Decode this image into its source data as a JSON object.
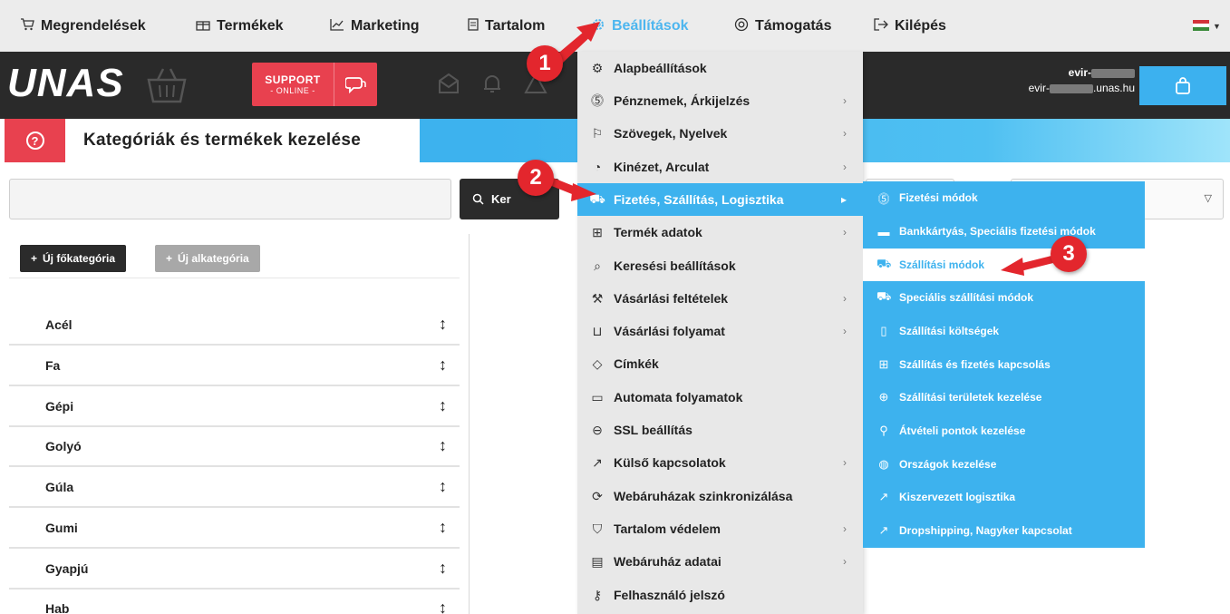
{
  "top_menu": {
    "items": [
      {
        "label": "Megrendelések",
        "icon": "cart-icon"
      },
      {
        "label": "Termékek",
        "icon": "gift-icon"
      },
      {
        "label": "Marketing",
        "icon": "chart-icon"
      },
      {
        "label": "Tartalom",
        "icon": "document-icon"
      },
      {
        "label": "Beállítások",
        "icon": "gear-icon",
        "active": true
      },
      {
        "label": "Támogatás",
        "icon": "lifebuoy-icon"
      },
      {
        "label": "Kilépés",
        "icon": "logout-icon"
      }
    ]
  },
  "header": {
    "logo": "UNAS",
    "support_line1": "SUPPORT",
    "support_line2": "- ONLINE -",
    "user_line1": "evir-",
    "user_line2_prefix": "evir-",
    "user_line2_suffix": ".unas.hu"
  },
  "page": {
    "title": "Kategóriák és termékek kezelése",
    "help_icon": "?"
  },
  "search": {
    "button_label": "Ker"
  },
  "categories": {
    "new_main_label": "Új főkategória",
    "new_sub_label": "Új alkategória",
    "items": [
      "Acél",
      "Fa",
      "Gépi",
      "Golyó",
      "Gúla",
      "Gumi",
      "Gyapjú",
      "Hab"
    ]
  },
  "settings_menu": {
    "items": [
      {
        "label": "Alapbeállítások",
        "icon": "gears-icon",
        "has_sub": false
      },
      {
        "label": "Pénznemek, Árkijelzés",
        "icon": "coin-icon",
        "has_sub": true
      },
      {
        "label": "Szövegek, Nyelvek",
        "icon": "flag-icon",
        "has_sub": true
      },
      {
        "label": "Kinézet, Arculat",
        "icon": "palette-icon",
        "has_sub": true
      },
      {
        "label": "Fizetés, Szállítás, Logisztika",
        "icon": "truck-icon",
        "has_sub": true,
        "highlighted": true
      },
      {
        "label": "Termék adatok",
        "icon": "gift-icon",
        "has_sub": true
      },
      {
        "label": "Keresési beállítások",
        "icon": "search-icon",
        "has_sub": false
      },
      {
        "label": "Vásárlási feltételek",
        "icon": "gavel-icon",
        "has_sub": true
      },
      {
        "label": "Vásárlási folyamat",
        "icon": "cart-icon",
        "has_sub": true
      },
      {
        "label": "Címkék",
        "icon": "tag-icon",
        "has_sub": false
      },
      {
        "label": "Automata folyamatok",
        "icon": "calendar-icon",
        "has_sub": false
      },
      {
        "label": "SSL beállítás",
        "icon": "lock-icon",
        "has_sub": false
      },
      {
        "label": "Külső kapcsolatok",
        "icon": "external-link-icon",
        "has_sub": true
      },
      {
        "label": "Webáruházak szinkronizálása",
        "icon": "sync-icon",
        "has_sub": false
      },
      {
        "label": "Tartalom védelem",
        "icon": "shield-icon",
        "has_sub": true
      },
      {
        "label": "Webáruház adatai",
        "icon": "file-icon",
        "has_sub": true
      },
      {
        "label": "Felhasználó jelszó",
        "icon": "key-icon",
        "has_sub": false
      }
    ]
  },
  "logistics_submenu": {
    "items": [
      {
        "label": "Fizetési módok",
        "icon": "coin-icon"
      },
      {
        "label": "Bankkártyás, Speciális fizetési módok",
        "icon": "credit-card-icon"
      },
      {
        "label": "Szállítási módok",
        "icon": "truck-icon",
        "selected": true
      },
      {
        "label": "Speciális szállítási módok",
        "icon": "truck-icon"
      },
      {
        "label": "Szállítási költségek",
        "icon": "receipt-icon"
      },
      {
        "label": "Szállítás és fizetés kapcsolás",
        "icon": "gift-icon"
      },
      {
        "label": "Szállítási területek kezelése",
        "icon": "area-icon"
      },
      {
        "label": "Átvételi pontok kezelése",
        "icon": "map-pin-icon"
      },
      {
        "label": "Országok kezelése",
        "icon": "globe-icon"
      },
      {
        "label": "Kiszervezett logisztika",
        "icon": "external-link-icon"
      },
      {
        "label": "Dropshipping, Nagyker kapcsolat",
        "icon": "external-link-icon"
      }
    ]
  },
  "markers": [
    "1",
    "2",
    "3"
  ],
  "colors": {
    "accent": "#3db2ee",
    "support_red": "#e8414f",
    "marker_red": "#e3262d",
    "dark": "#2a2a2a"
  }
}
